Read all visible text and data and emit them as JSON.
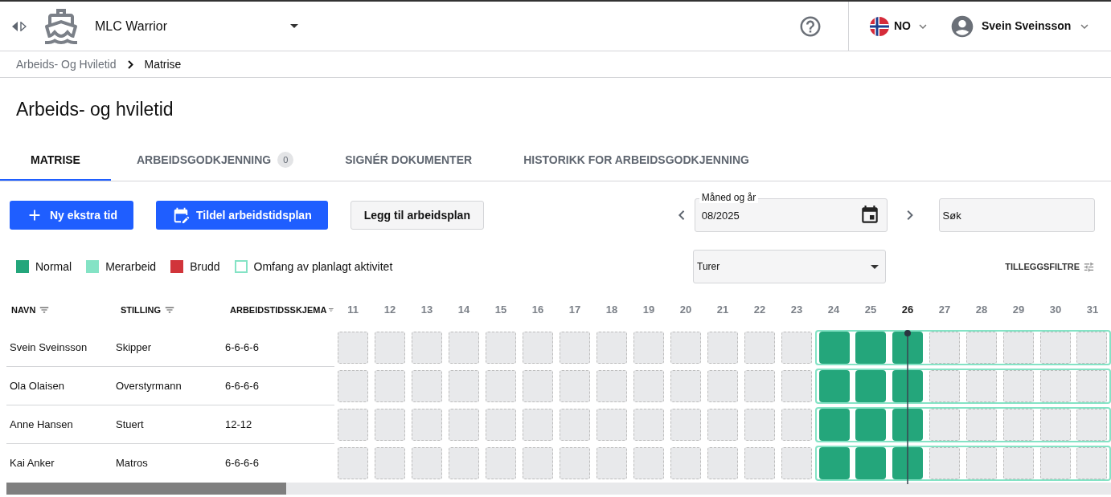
{
  "header": {
    "vessel": "MLC Warrior",
    "language": "NO",
    "user": "Svein Sveinsson"
  },
  "breadcrumb": [
    {
      "label": "Arbeids- Og Hviletid",
      "current": false
    },
    {
      "label": "Matrise",
      "current": true
    }
  ],
  "page_title": "Arbeids- og hviletid",
  "tabs": [
    {
      "label": "MATRISE",
      "selected": true
    },
    {
      "label": "ARBEIDSGODKJENNING",
      "badge": "0",
      "selected": false
    },
    {
      "label": "SIGNÉR DOKUMENTER",
      "selected": false
    },
    {
      "label": "HISTORIKK FOR ARBEIDSGODKJENNING",
      "selected": false
    }
  ],
  "actions": [
    {
      "label": "Ny ekstra tid",
      "kind": "add"
    },
    {
      "label": "Tildel arbeidstidsplan",
      "kind": "assign"
    },
    {
      "label": "Legg til arbeidsplan",
      "kind": "secondary"
    }
  ],
  "month_field": {
    "label": "Måned og år",
    "value": "08/2025"
  },
  "search": {
    "placeholder": "Søk"
  },
  "trips_select": {
    "value": "Turer"
  },
  "extra_filters": "TILLEGGSFILTRE",
  "legend": [
    {
      "label": "Normal",
      "color": "#24a67b",
      "kind": "fill"
    },
    {
      "label": "Merarbeid",
      "color": "#84e3c5",
      "kind": "fill"
    },
    {
      "label": "Brudd",
      "color": "#d1343a",
      "kind": "fill"
    },
    {
      "label": "Omfang av planlagt aktivitet",
      "color": "#84e3c5",
      "kind": "outline"
    }
  ],
  "table": {
    "columns": [
      {
        "label": "NAVN"
      },
      {
        "label": "STILLING"
      },
      {
        "label": "ARBEIDSTIDSSKJEMA"
      }
    ],
    "days": [
      {
        "label": "11",
        "selected": false
      },
      {
        "label": "12",
        "selected": false
      },
      {
        "label": "13",
        "selected": false
      },
      {
        "label": "14",
        "selected": false
      },
      {
        "label": "15",
        "selected": false
      },
      {
        "label": "16",
        "selected": false
      },
      {
        "label": "17",
        "selected": false
      },
      {
        "label": "18",
        "selected": false
      },
      {
        "label": "19",
        "selected": false
      },
      {
        "label": "20",
        "selected": false
      },
      {
        "label": "21",
        "selected": false
      },
      {
        "label": "22",
        "selected": false
      },
      {
        "label": "23",
        "selected": false
      },
      {
        "label": "24",
        "selected": false
      },
      {
        "label": "25",
        "selected": false
      },
      {
        "label": "26",
        "selected": true
      },
      {
        "label": "27",
        "selected": false
      },
      {
        "label": "28",
        "selected": false
      },
      {
        "label": "29",
        "selected": false
      },
      {
        "label": "30",
        "selected": false
      },
      {
        "label": "31",
        "selected": false
      }
    ],
    "rows": [
      {
        "name": "Svein Sveinsson",
        "position": "Skipper",
        "schedule": "6-6-6-6",
        "cells": [
          {
            "kind": "empty",
            "planned": false
          },
          {
            "kind": "empty",
            "planned": false
          },
          {
            "kind": "empty",
            "planned": false
          },
          {
            "kind": "empty",
            "planned": false
          },
          {
            "kind": "empty",
            "planned": false
          },
          {
            "kind": "empty",
            "planned": false
          },
          {
            "kind": "empty",
            "planned": false
          },
          {
            "kind": "empty",
            "planned": false
          },
          {
            "kind": "empty",
            "planned": false
          },
          {
            "kind": "empty",
            "planned": false
          },
          {
            "kind": "empty",
            "planned": false
          },
          {
            "kind": "empty",
            "planned": false
          },
          {
            "kind": "empty",
            "planned": false
          },
          {
            "kind": "normal",
            "planned": true
          },
          {
            "kind": "normal",
            "planned": true
          },
          {
            "kind": "normal",
            "planned": true
          },
          {
            "kind": "empty",
            "planned": true
          },
          {
            "kind": "empty",
            "planned": true
          },
          {
            "kind": "empty",
            "planned": true
          },
          {
            "kind": "empty",
            "planned": true
          },
          {
            "kind": "empty",
            "planned": true
          }
        ]
      },
      {
        "name": "Ola Olaisen",
        "position": "Overstyrmann",
        "schedule": "6-6-6-6",
        "cells": [
          {
            "kind": "empty",
            "planned": false
          },
          {
            "kind": "empty",
            "planned": false
          },
          {
            "kind": "empty",
            "planned": false
          },
          {
            "kind": "empty",
            "planned": false
          },
          {
            "kind": "empty",
            "planned": false
          },
          {
            "kind": "empty",
            "planned": false
          },
          {
            "kind": "empty",
            "planned": false
          },
          {
            "kind": "empty",
            "planned": false
          },
          {
            "kind": "empty",
            "planned": false
          },
          {
            "kind": "empty",
            "planned": false
          },
          {
            "kind": "empty",
            "planned": false
          },
          {
            "kind": "empty",
            "planned": false
          },
          {
            "kind": "empty",
            "planned": false
          },
          {
            "kind": "normal",
            "planned": true
          },
          {
            "kind": "normal",
            "planned": true
          },
          {
            "kind": "normal",
            "planned": true
          },
          {
            "kind": "empty",
            "planned": true
          },
          {
            "kind": "empty",
            "planned": true
          },
          {
            "kind": "empty",
            "planned": true
          },
          {
            "kind": "empty",
            "planned": true
          },
          {
            "kind": "empty",
            "planned": true
          }
        ]
      },
      {
        "name": "Anne Hansen",
        "position": "Stuert",
        "schedule": "12-12",
        "cells": [
          {
            "kind": "empty",
            "planned": false
          },
          {
            "kind": "empty",
            "planned": false
          },
          {
            "kind": "empty",
            "planned": false
          },
          {
            "kind": "empty",
            "planned": false
          },
          {
            "kind": "empty",
            "planned": false
          },
          {
            "kind": "empty",
            "planned": false
          },
          {
            "kind": "empty",
            "planned": false
          },
          {
            "kind": "empty",
            "planned": false
          },
          {
            "kind": "empty",
            "planned": false
          },
          {
            "kind": "empty",
            "planned": false
          },
          {
            "kind": "empty",
            "planned": false
          },
          {
            "kind": "empty",
            "planned": false
          },
          {
            "kind": "empty",
            "planned": false
          },
          {
            "kind": "normal",
            "planned": true
          },
          {
            "kind": "normal",
            "planned": true
          },
          {
            "kind": "normal",
            "planned": true
          },
          {
            "kind": "empty",
            "planned": true
          },
          {
            "kind": "empty",
            "planned": true
          },
          {
            "kind": "empty",
            "planned": true
          },
          {
            "kind": "empty",
            "planned": true
          },
          {
            "kind": "empty",
            "planned": true
          }
        ]
      },
      {
        "name": "Kai Anker",
        "position": "Matros",
        "schedule": "6-6-6-6",
        "cells": [
          {
            "kind": "empty",
            "planned": false
          },
          {
            "kind": "empty",
            "planned": false
          },
          {
            "kind": "empty",
            "planned": false
          },
          {
            "kind": "empty",
            "planned": false
          },
          {
            "kind": "empty",
            "planned": false
          },
          {
            "kind": "empty",
            "planned": false
          },
          {
            "kind": "empty",
            "planned": false
          },
          {
            "kind": "empty",
            "planned": false
          },
          {
            "kind": "empty",
            "planned": false
          },
          {
            "kind": "empty",
            "planned": false
          },
          {
            "kind": "empty",
            "planned": false
          },
          {
            "kind": "empty",
            "planned": false
          },
          {
            "kind": "empty",
            "planned": false
          },
          {
            "kind": "normal",
            "planned": true
          },
          {
            "kind": "normal",
            "planned": true
          },
          {
            "kind": "normal",
            "planned": true
          },
          {
            "kind": "empty",
            "planned": true
          },
          {
            "kind": "empty",
            "planned": true
          },
          {
            "kind": "empty",
            "planned": true
          },
          {
            "kind": "empty",
            "planned": true
          },
          {
            "kind": "empty",
            "planned": true
          }
        ]
      }
    ]
  }
}
